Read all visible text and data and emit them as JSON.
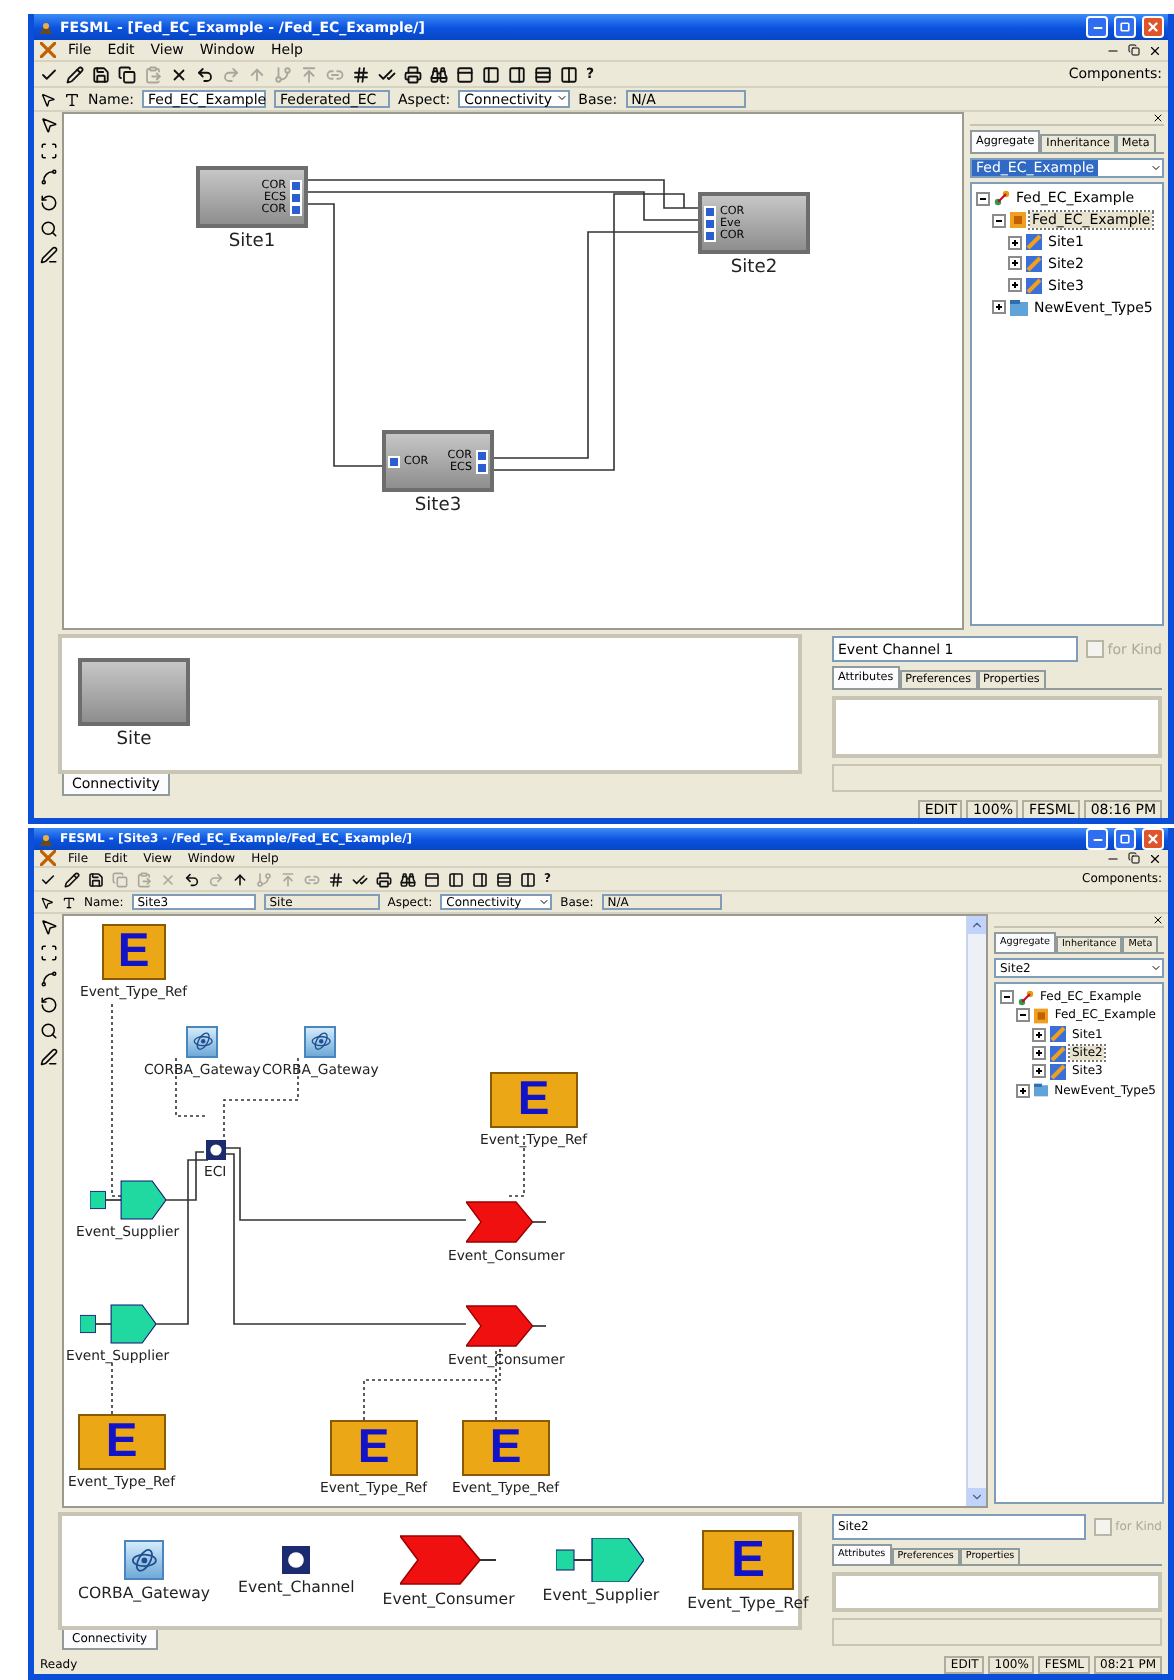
{
  "windows": [
    {
      "title": "FESML - [Fed_EC_Example - /Fed_EC_Example/]",
      "menu": [
        "File",
        "Edit",
        "View",
        "Window",
        "Help"
      ],
      "toolbar": [
        {
          "kind": "check",
          "disabled": false
        },
        {
          "kind": "edit",
          "disabled": false
        },
        {
          "kind": "save",
          "disabled": false
        },
        {
          "kind": "copy",
          "disabled": false
        },
        {
          "kind": "paste",
          "disabled": true
        },
        {
          "kind": "delete",
          "disabled": false
        },
        {
          "kind": "undo",
          "disabled": false
        },
        {
          "kind": "redo",
          "disabled": true
        },
        {
          "kind": "up",
          "disabled": true
        },
        {
          "kind": "up_branch",
          "disabled": true
        },
        {
          "kind": "up_all",
          "disabled": true
        },
        {
          "kind": "connect",
          "disabled": true
        },
        {
          "kind": "hash",
          "disabled": false
        },
        {
          "kind": "validate",
          "disabled": false
        },
        {
          "kind": "print",
          "disabled": false
        },
        {
          "kind": "find",
          "disabled": false
        },
        {
          "kind": "view_a",
          "disabled": false
        },
        {
          "kind": "view_b",
          "disabled": false
        },
        {
          "kind": "view_c",
          "disabled": false
        },
        {
          "kind": "view_d",
          "disabled": false
        },
        {
          "kind": "view_e",
          "disabled": false
        }
      ],
      "help": "?",
      "components_label": "Components:",
      "name_bar": {
        "name_label": "Name:",
        "name": "Fed_EC_Example",
        "kind": "Federated_EC",
        "aspect_label": "Aspect:",
        "aspect": "Connectivity",
        "base_label": "Base:",
        "base": "N/A"
      },
      "scrollable": false,
      "diagram": {
        "nodes": [
          {
            "kind": "site",
            "label": "Site1",
            "right_ports": [
              "COR",
              "ECS",
              "COR"
            ]
          },
          {
            "kind": "site",
            "label": "Site2",
            "left_ports": [
              "COR",
              "Eve",
              "COR"
            ]
          },
          {
            "kind": "site",
            "label": "Site3",
            "left_ports": [
              "COR"
            ],
            "right_ports": [
              "COR",
              "ECS"
            ]
          }
        ]
      },
      "browser": {
        "tabs": [
          {
            "label": "Aggregate",
            "selected": true
          },
          {
            "label": "Inheritance",
            "selected": false
          },
          {
            "label": "Meta",
            "selected": false
          }
        ],
        "selector": {
          "value": "Fed_EC_Example",
          "highlighted": true
        },
        "tree": [
          {
            "label": "Fed_EC_Example",
            "kind": "root",
            "expanded": true,
            "selected": false,
            "children": [
              {
                "label": "Fed_EC_Example",
                "kind": "model",
                "expanded": true,
                "selected": true,
                "children": [
                  {
                    "label": "Site1",
                    "kind": "site",
                    "expanded": false,
                    "selected": false
                  },
                  {
                    "label": "Site2",
                    "kind": "site",
                    "expanded": false,
                    "selected": false
                  },
                  {
                    "label": "Site3",
                    "kind": "site",
                    "expanded": false,
                    "selected": false
                  }
                ]
              },
              {
                "label": "NewEvent_Type5",
                "kind": "event_type",
                "expanded": false,
                "selected": false
              }
            ]
          }
        ]
      },
      "parts": {
        "items": [
          {
            "kind": "site",
            "label": "Site"
          }
        ],
        "tab": "Connectivity"
      },
      "attributes": {
        "name": "Event Channel 1",
        "for_kind": {
          "label": "for Kind",
          "checked": false,
          "disabled": true
        },
        "tabs": [
          {
            "label": "Attributes",
            "selected": true
          },
          {
            "label": "Preferences",
            "selected": false
          },
          {
            "label": "Properties",
            "selected": false
          }
        ]
      },
      "status": {
        "fields": [
          "EDIT",
          "100%",
          "FESML",
          "08:16 PM"
        ]
      }
    },
    {
      "title": "FESML - [Site3 - /Fed_EC_Example/Fed_EC_Example/]",
      "menu": [
        "File",
        "Edit",
        "View",
        "Window",
        "Help"
      ],
      "toolbar": [
        {
          "kind": "check",
          "disabled": false
        },
        {
          "kind": "edit",
          "disabled": false
        },
        {
          "kind": "save",
          "disabled": false
        },
        {
          "kind": "copy",
          "disabled": true
        },
        {
          "kind": "paste",
          "disabled": true
        },
        {
          "kind": "delete",
          "disabled": true
        },
        {
          "kind": "undo",
          "disabled": false
        },
        {
          "kind": "redo",
          "disabled": true
        },
        {
          "kind": "up",
          "disabled": false
        },
        {
          "kind": "up_branch",
          "disabled": true
        },
        {
          "kind": "up_all",
          "disabled": true
        },
        {
          "kind": "connect",
          "disabled": true
        },
        {
          "kind": "hash",
          "disabled": false
        },
        {
          "kind": "validate",
          "disabled": false
        },
        {
          "kind": "print",
          "disabled": false
        },
        {
          "kind": "find",
          "disabled": false
        },
        {
          "kind": "view_a",
          "disabled": false
        },
        {
          "kind": "view_b",
          "disabled": false
        },
        {
          "kind": "view_c",
          "disabled": false
        },
        {
          "kind": "view_d",
          "disabled": false
        },
        {
          "kind": "view_e",
          "disabled": false
        }
      ],
      "help": "?",
      "components_label": "Components:",
      "name_bar": {
        "name_label": "Name:",
        "name": "Site3",
        "kind": "Site",
        "aspect_label": "Aspect:",
        "aspect": "Connectivity",
        "base_label": "Base:",
        "base": "N/A"
      },
      "scrollable": true,
      "diagram": {
        "nodes": [
          {
            "kind": "event_type_ref",
            "label": "Event_Type_Ref",
            "glyph": "E"
          },
          {
            "kind": "corba_gateway",
            "label": "CORBA_Gateway"
          },
          {
            "kind": "corba_gateway",
            "label": "CORBA_Gateway"
          },
          {
            "kind": "event_type_ref",
            "label": "Event_Type_Ref",
            "glyph": "E"
          },
          {
            "kind": "event_channel",
            "label": "ECI"
          },
          {
            "kind": "event_supplier",
            "label": "Event_Supplier"
          },
          {
            "kind": "event_consumer",
            "label": "Event_Consumer"
          },
          {
            "kind": "event_supplier",
            "label": "Event_Supplier"
          },
          {
            "kind": "event_consumer",
            "label": "Event_Consumer"
          },
          {
            "kind": "event_type_ref",
            "label": "Event_Type_Ref",
            "glyph": "E"
          },
          {
            "kind": "event_type_ref",
            "label": "Event_Type_Ref",
            "glyph": "E"
          },
          {
            "kind": "event_type_ref",
            "label": "Event_Type_Ref",
            "glyph": "E"
          }
        ]
      },
      "browser": {
        "tabs": [
          {
            "label": "Aggregate",
            "selected": true
          },
          {
            "label": "Inheritance",
            "selected": false
          },
          {
            "label": "Meta",
            "selected": false
          }
        ],
        "selector": {
          "value": "Site2",
          "highlighted": false
        },
        "tree": [
          {
            "label": "Fed_EC_Example",
            "kind": "root",
            "expanded": true,
            "selected": false,
            "children": [
              {
                "label": "Fed_EC_Example",
                "kind": "model",
                "expanded": true,
                "selected": false,
                "children": [
                  {
                    "label": "Site1",
                    "kind": "site",
                    "expanded": false,
                    "selected": false
                  },
                  {
                    "label": "Site2",
                    "kind": "site",
                    "expanded": false,
                    "selected": true
                  },
                  {
                    "label": "Site3",
                    "kind": "site",
                    "expanded": false,
                    "selected": false
                  }
                ]
              },
              {
                "label": "NewEvent_Type5",
                "kind": "event_type",
                "expanded": false,
                "selected": false
              }
            ]
          }
        ]
      },
      "parts": {
        "items": [
          {
            "kind": "corba_gateway",
            "label": "CORBA_Gateway"
          },
          {
            "kind": "event_channel",
            "label": "Event_Channel"
          },
          {
            "kind": "event_consumer",
            "label": "Event_Consumer"
          },
          {
            "kind": "event_supplier",
            "label": "Event_Supplier"
          },
          {
            "kind": "event_type_ref",
            "label": "Event_Type_Ref",
            "glyph": "E"
          }
        ],
        "tab": "Connectivity"
      },
      "attributes": {
        "name": "Site2",
        "for_kind": {
          "label": "for Kind",
          "checked": false,
          "disabled": true
        },
        "tabs": [
          {
            "label": "Attributes",
            "selected": true
          },
          {
            "label": "Preferences",
            "selected": false
          },
          {
            "label": "Properties",
            "selected": false
          }
        ]
      },
      "status": {
        "message": "Ready",
        "fields": [
          "EDIT",
          "100%",
          "FESML",
          "08:21 PM"
        ]
      }
    }
  ]
}
